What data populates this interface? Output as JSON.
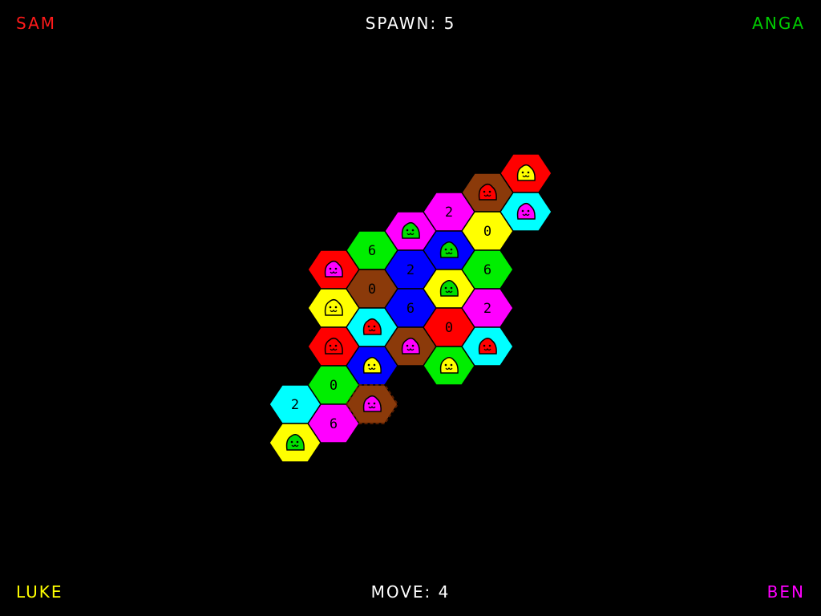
{
  "players": {
    "top_left": {
      "name": "SAM",
      "color": "#ff1a1a"
    },
    "top_right": {
      "name": "ANGA",
      "color": "#00cc00"
    },
    "bottom_left": {
      "name": "LUKE",
      "color": "#ffff00"
    },
    "bottom_right": {
      "name": "BEN",
      "color": "#ff00ff"
    }
  },
  "counters": {
    "spawn": "SPAWN: 5",
    "move": "MOVE: 4"
  },
  "tile_colors": {
    "red": "#ff0000",
    "green": "#00ee00",
    "magenta": "#ff00ff",
    "brown": "#8b3a0a",
    "yellow": "#ffff00",
    "cyan": "#00ffff",
    "blue": "#0000ff"
  },
  "creature_colors": {
    "red": "#ff0000",
    "green": "#00dd00",
    "magenta": "#ff00ff",
    "yellow": "#ffff00"
  },
  "tiles": [
    {
      "col": 0,
      "row": 0,
      "color": "red",
      "creature": "magenta"
    },
    {
      "col": 0,
      "row": 1,
      "color": "yellow",
      "creature": "yellow"
    },
    {
      "col": 0,
      "row": 2,
      "color": "red",
      "creature": "red"
    },
    {
      "col": 0,
      "row": 3,
      "color": "green",
      "number": "0"
    },
    {
      "col": 0,
      "row": 4,
      "color": "magenta",
      "number": "6"
    },
    {
      "col": 1,
      "row": 0,
      "color": "green",
      "number": "6"
    },
    {
      "col": 1,
      "row": 1,
      "color": "brown",
      "number": "0"
    },
    {
      "col": 1,
      "row": 2,
      "color": "cyan",
      "creature": "red"
    },
    {
      "col": 1,
      "row": 3,
      "color": "blue",
      "creature": "yellow"
    },
    {
      "col": 1,
      "row": 4,
      "color": "brown",
      "creature": "magenta",
      "selected": true
    },
    {
      "col": 2,
      "row": 0,
      "color": "magenta",
      "creature": "green"
    },
    {
      "col": 2,
      "row": 1,
      "color": "blue",
      "number": "2"
    },
    {
      "col": 2,
      "row": 2,
      "color": "blue",
      "number": "6"
    },
    {
      "col": 2,
      "row": 3,
      "color": "brown",
      "creature": "magenta"
    },
    {
      "col": 3,
      "row": 0,
      "color": "magenta",
      "number": "2"
    },
    {
      "col": 3,
      "row": 1,
      "color": "blue",
      "creature": "green"
    },
    {
      "col": 3,
      "row": 2,
      "color": "yellow",
      "creature": "green"
    },
    {
      "col": 3,
      "row": 3,
      "color": "red",
      "number": "0"
    },
    {
      "col": 3,
      "row": 4,
      "color": "green",
      "creature": "yellow"
    },
    {
      "col": 4,
      "row": 0,
      "color": "brown",
      "creature": "red"
    },
    {
      "col": 4,
      "row": 1,
      "color": "yellow",
      "number": "0"
    },
    {
      "col": 4,
      "row": 2,
      "color": "green",
      "number": "6"
    },
    {
      "col": 4,
      "row": 3,
      "color": "magenta",
      "number": "2"
    },
    {
      "col": 4,
      "row": 4,
      "color": "cyan",
      "creature": "red"
    },
    {
      "col": 5,
      "row": 0,
      "color": "red",
      "creature": "yellow"
    },
    {
      "col": 5,
      "row": 1,
      "color": "cyan",
      "creature": "magenta"
    },
    {
      "col": -1,
      "row": 3,
      "color": "cyan",
      "number": "2"
    },
    {
      "col": -1,
      "row": 4,
      "color": "yellow",
      "creature": "green"
    }
  ]
}
